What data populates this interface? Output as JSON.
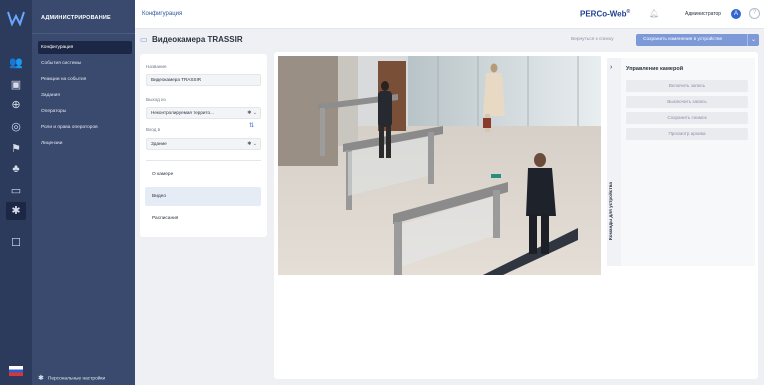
{
  "app": {
    "section_title": "АДМИНИСТРИРОВАНИЕ",
    "breadcrumb": "Конфигурация",
    "brand": "PERCo-Web",
    "brand_mark": "®",
    "user": "Администратор",
    "user_initial": "A",
    "help": "?"
  },
  "rail": {
    "icons": [
      "logo-icon",
      "users-icon",
      "events-icon",
      "reactions-icon",
      "tasks-icon",
      "operators-icon",
      "roles-icon",
      "gear-icon",
      "chat-icon"
    ]
  },
  "sidebar": {
    "items": [
      {
        "label": "Конфигурация",
        "active": true
      },
      {
        "label": "События системы"
      },
      {
        "label": "Реакции на события"
      },
      {
        "label": "Задания"
      },
      {
        "label": "Операторы"
      },
      {
        "label": "Роли и права операторов"
      },
      {
        "label": "Лицензии"
      }
    ],
    "footer": "Персональные настройки"
  },
  "page": {
    "title": "Видеокамера TRASSIR",
    "back_link": "Вернуться к списку",
    "save_button": "Сохранить изменения в устройстве"
  },
  "form": {
    "name_label": "Название",
    "name_value": "Видеокамера TRASSIR",
    "exit_label": "Выход из",
    "exit_value": "Неконтролируемая террито...",
    "entry_label": "Вход в",
    "entry_value": "Здание"
  },
  "tabs": [
    {
      "label": "О камере"
    },
    {
      "label": "Видео",
      "active": true
    },
    {
      "label": "Расписания"
    }
  ],
  "camera_panel": {
    "vertical_label": "Команды для устройства",
    "title": "Управление камерой",
    "buttons": [
      "Включить запись",
      "Выключить запись",
      "Сохранить снимок",
      "Просмотр архива"
    ]
  }
}
